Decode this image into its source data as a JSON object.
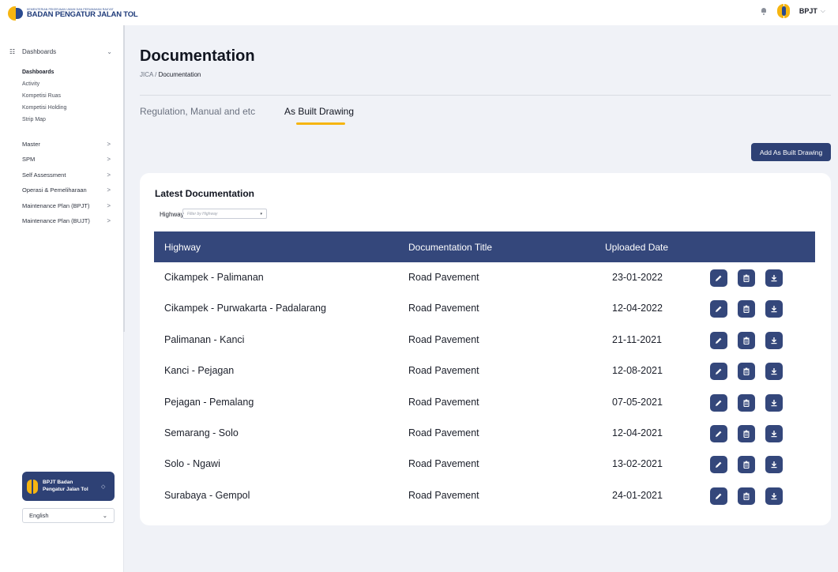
{
  "topbar": {
    "logo_sub": "KEMENTERIAN PEKERJAAN UMUM DAN PERUMAHAN RAKYAT",
    "logo_main": "BADAN PENGATUR JALAN TOL",
    "user_name": "BPJT",
    "bell_icon": "bell-icon",
    "user_chevron": "⌵"
  },
  "sidebar": {
    "section_label": "Dashboards",
    "section_icon": "☷",
    "section_chevron": "⌄",
    "sub_items": [
      {
        "label": "Dashboards",
        "active": true
      },
      {
        "label": "Activity"
      },
      {
        "label": "Kompetisi Ruas"
      },
      {
        "label": "Kompetisi Holding"
      },
      {
        "label": "Strip Map"
      }
    ],
    "groups": [
      {
        "label": "Master",
        "chevron": ">"
      },
      {
        "label": "SPM",
        "chevron": ">"
      },
      {
        "label": "Self Assessment",
        "chevron": ">"
      },
      {
        "label": "Operasi & Pemeliharaan",
        "chevron": ">"
      },
      {
        "label": "Maintenance Plan (BPJT)",
        "chevron": ">"
      },
      {
        "label": "Maintenance Plan (BUJT)",
        "chevron": ">"
      }
    ],
    "org_name": "BPJT Badan Pengatur Jalan Tol",
    "org_chevron": "◇",
    "language": "English",
    "language_chevron": "⌄"
  },
  "main": {
    "title": "Documentation",
    "breadcrumb_root": "JICA / ",
    "breadcrumb_current": "Documentation",
    "tabs": [
      {
        "label": "Regulation, Manual and etc",
        "active": false
      },
      {
        "label": "As Built Drawing",
        "active": true
      }
    ],
    "add_button": "Add As Built Drawing",
    "card_title": "Latest Documentation",
    "filter_label": "Highway",
    "filter_placeholder": "Filter by Highway",
    "filter_arrow": "▾",
    "columns": [
      "Highway",
      "Documentation Title",
      "Uploaded Date"
    ],
    "rows": [
      {
        "highway": "Cikampek - Palimanan",
        "title": "Road Pavement",
        "date": "23-01-2022"
      },
      {
        "highway": "Cikampek - Purwakarta - Padalarang",
        "title": "Road Pavement",
        "date": "12-04-2022"
      },
      {
        "highway": "Palimanan - Kanci",
        "title": "Road Pavement",
        "date": "21-11-2021"
      },
      {
        "highway": "Kanci - Pejagan",
        "title": "Road Pavement",
        "date": "12-08-2021"
      },
      {
        "highway": "Pejagan - Pemalang",
        "title": "Road Pavement",
        "date": "07-05-2021"
      },
      {
        "highway": "Semarang - Solo",
        "title": "Road Pavement",
        "date": "12-04-2021"
      },
      {
        "highway": "Solo - Ngawi",
        "title": "Road Pavement",
        "date": "13-02-2021"
      },
      {
        "highway": "Surabaya - Gempol",
        "title": "Road Pavement",
        "date": "24-01-2021"
      }
    ],
    "row_actions": [
      "edit-icon",
      "trash-icon",
      "download-icon"
    ]
  },
  "colors": {
    "brand_navy": "#2e4175",
    "table_header": "#34477b",
    "accent_yellow": "#f6b511",
    "page_bg": "#f0f2f7"
  }
}
